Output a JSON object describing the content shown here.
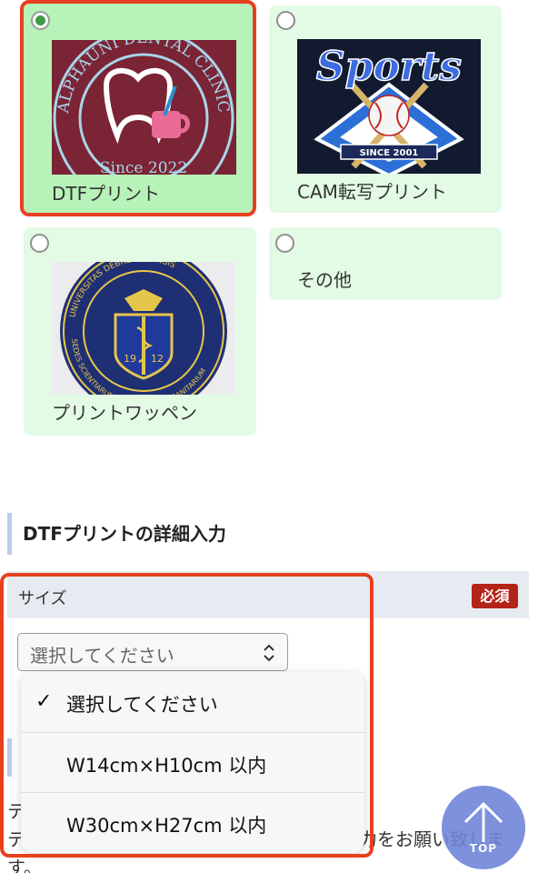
{
  "options": [
    {
      "label": "DTFプリント",
      "selected": true,
      "logo_text": "ALPHAUNI DENTAL CLINIC",
      "logo_year": "Since 2022"
    },
    {
      "label": "CAM転写プリント",
      "selected": false,
      "logo_text": "Sports",
      "logo_year": "SINCE 2001"
    },
    {
      "label": "プリントワッペン",
      "selected": false,
      "logo_text": "UNIVERSITAS DEBRECENIENSIS",
      "logo_bottom": "SEDES SCIENTIARUM MEDICORUM ET SANITARIUM",
      "logo_year_left": "19",
      "logo_year_right": "12"
    },
    {
      "label": "その他",
      "selected": false
    }
  ],
  "section": {
    "title": "DTFプリントの詳細入力"
  },
  "size_field": {
    "label": "サイズ",
    "required_badge": "必須",
    "select_value": "選択してください"
  },
  "dropdown": {
    "items": [
      {
        "label": "選択してください",
        "checked": true
      },
      {
        "label": "W14cm×H10cm 以内",
        "checked": false
      },
      {
        "label": "W30cm×H27cm 以内",
        "checked": false
      }
    ]
  },
  "behind_text": {
    "line1": "テ",
    "line2": "テ",
    "line2_tail": "力をお願い致しま",
    "line3": "す。"
  },
  "top_button": {
    "label": "TOP"
  },
  "colors": {
    "card_bg": "#e3fbe5",
    "card_selected_bg": "#b7f2b9",
    "highlight": "#e8401f",
    "required": "#b42318",
    "top_button": "#6f86d9"
  }
}
